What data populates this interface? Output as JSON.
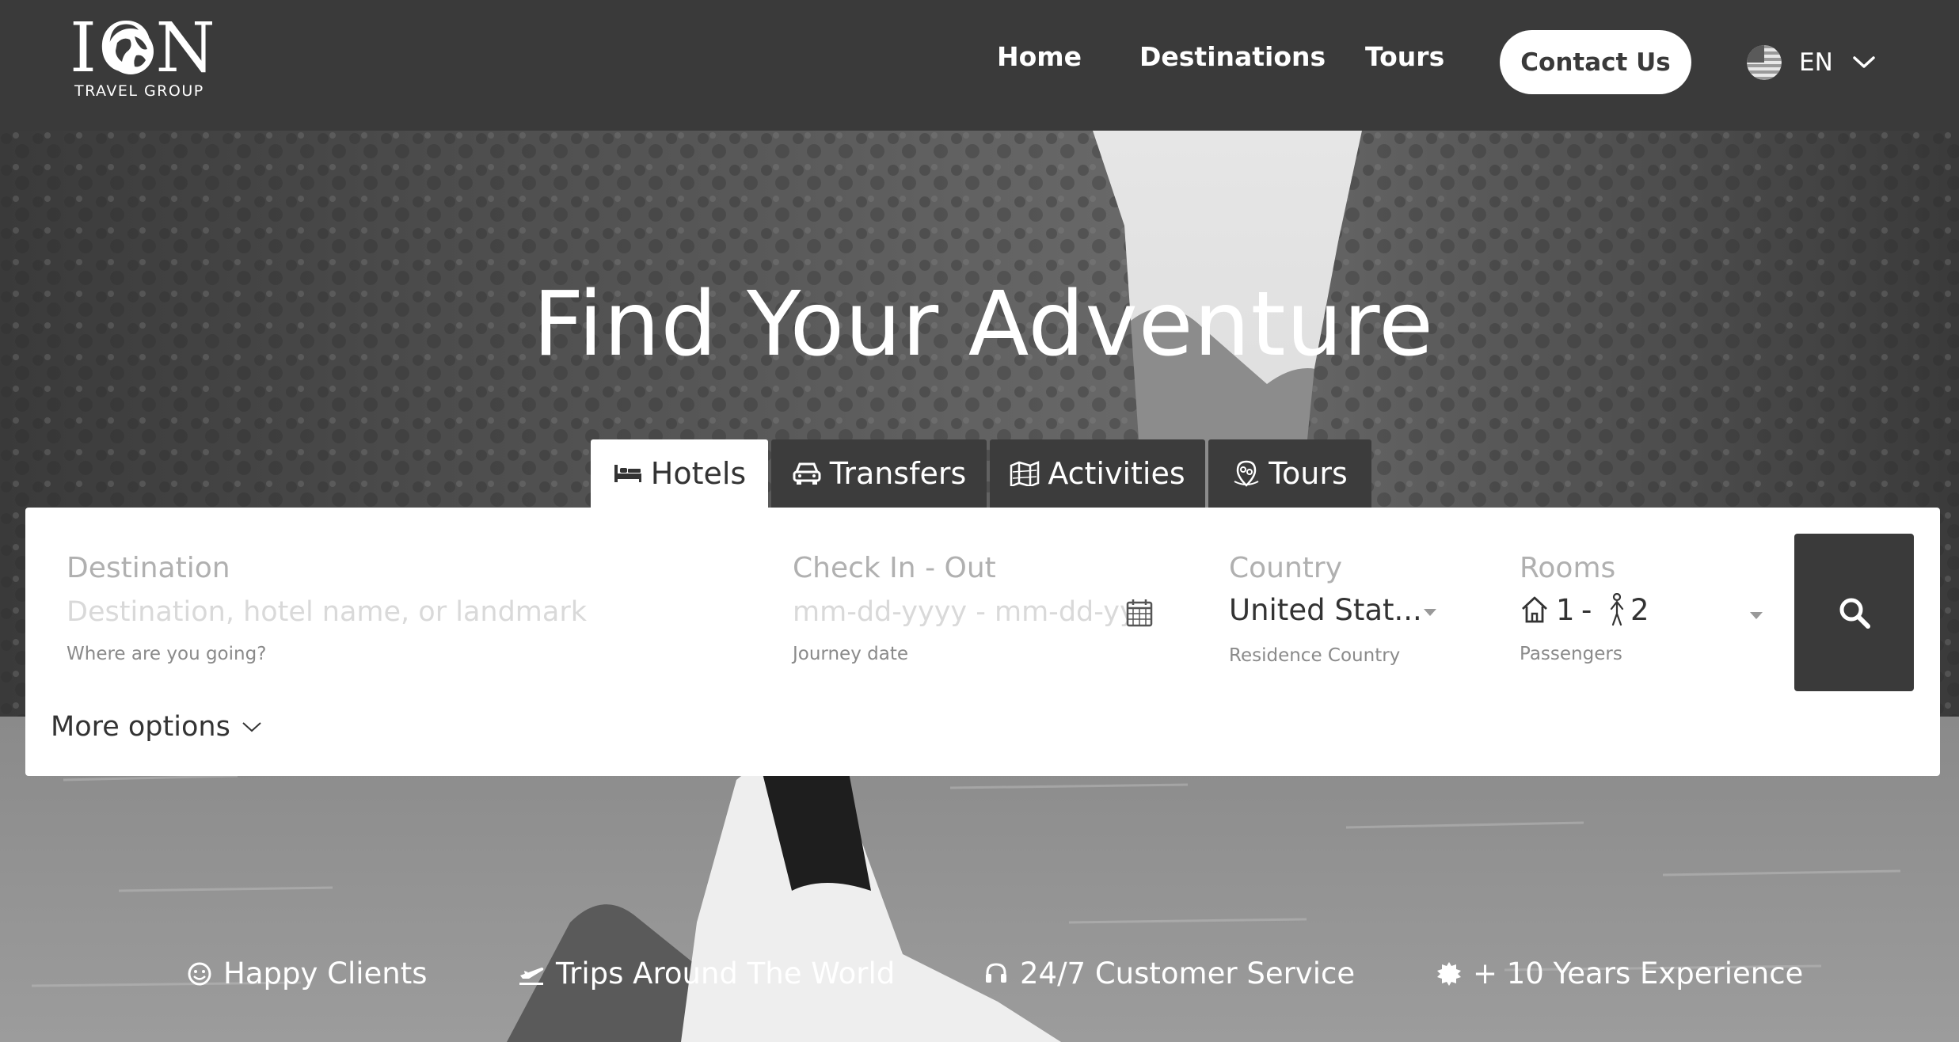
{
  "brand": {
    "logo_text": "ION",
    "logo_subtitle": "TRAVEL GROUP"
  },
  "nav": {
    "links": [
      "Home",
      "Destinations",
      "Tours"
    ],
    "contact_label": "Contact Us",
    "language": "EN"
  },
  "hero": {
    "title": "Find Your Adventure"
  },
  "tabs": [
    {
      "label": "Hotels",
      "icon": "bed-icon",
      "active": true
    },
    {
      "label": "Transfers",
      "icon": "car-icon",
      "active": false
    },
    {
      "label": "Activities",
      "icon": "map-icon",
      "active": false
    },
    {
      "label": "Tours",
      "icon": "tour-pin-icon",
      "active": false
    }
  ],
  "search": {
    "destination": {
      "label": "Destination",
      "placeholder": "Destination, hotel name, or landmark",
      "hint": "Where are you going?"
    },
    "dates": {
      "label": "Check In - Out",
      "placeholder": "mm-dd-yyyy - mm-dd-yyyy",
      "hint": "Journey date"
    },
    "country": {
      "label": "Country",
      "value": "United Stat...",
      "hint": "Residence Country"
    },
    "rooms": {
      "label": "Rooms",
      "rooms_count": "1",
      "separator": "-",
      "passengers_count": "2",
      "hint": "Passengers"
    },
    "more_options_label": "More options"
  },
  "stats": [
    {
      "label": "Happy Clients",
      "icon": "smiley-icon"
    },
    {
      "label": "Trips Around The World",
      "icon": "plane-icon"
    },
    {
      "label": "24/7 Customer Service",
      "icon": "headset-icon"
    },
    {
      "label": "+ 10 Years Experience",
      "icon": "badge-icon"
    }
  ],
  "colors": {
    "header_bg": "#3a3a3a",
    "search_button": "#3a3a3a",
    "panel_bg": "#ffffff"
  }
}
